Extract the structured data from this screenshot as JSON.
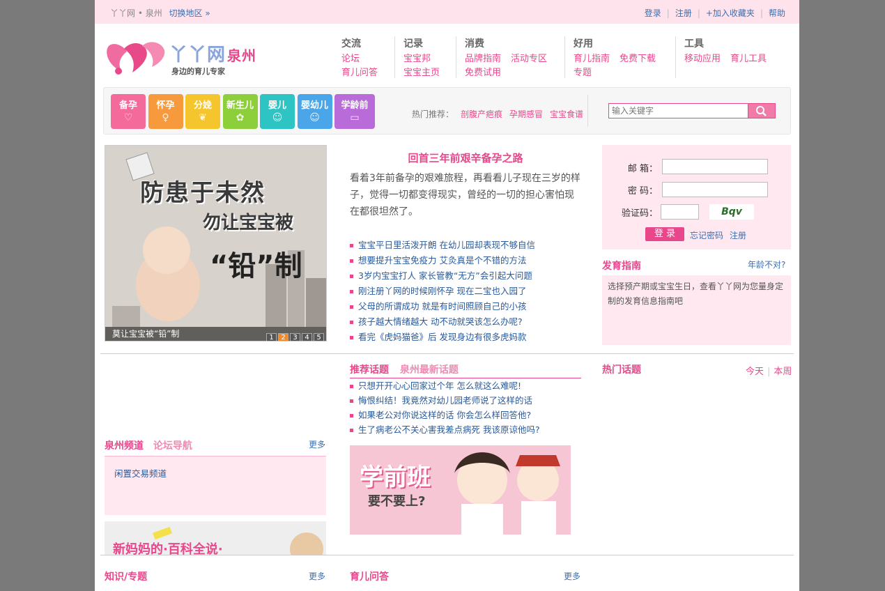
{
  "topbar": {
    "site_location": "丫丫网 • 泉州",
    "switch_region": "切换地区",
    "login": "登录",
    "register": "注册",
    "bookmark": "+加入收藏夹",
    "help": "帮助"
  },
  "logo": {
    "brand": "丫丫网",
    "city": "泉州",
    "slogan": "身边的育儿专家"
  },
  "nav": [
    {
      "heading": "交流",
      "rows": [
        [
          "论坛"
        ],
        [
          "育儿问答"
        ]
      ]
    },
    {
      "heading": "记录",
      "rows": [
        [
          "宝宝邦"
        ],
        [
          "宝宝主页"
        ]
      ]
    },
    {
      "heading": "消费",
      "rows": [
        [
          "品牌指南",
          "活动专区"
        ],
        [
          "免费试用"
        ]
      ]
    },
    {
      "heading": "好用",
      "rows": [
        [
          "育儿指南",
          "免费下载"
        ],
        [
          "专题"
        ]
      ]
    },
    {
      "heading": "工具",
      "rows": [
        [
          "移动应用",
          "育儿工具"
        ]
      ]
    }
  ],
  "categories": [
    {
      "label": "备孕",
      "color": "#f46a9b",
      "icon": "♡"
    },
    {
      "label": "怀孕",
      "color": "#f79a3e",
      "icon": "♀"
    },
    {
      "label": "分娩",
      "color": "#f5c52e",
      "icon": "❦"
    },
    {
      "label": "新生儿",
      "color": "#8ccf3a",
      "icon": "✿"
    },
    {
      "label": "婴儿",
      "color": "#2ec4c4",
      "icon": "☺"
    },
    {
      "label": "婴幼儿",
      "color": "#4aa6e8",
      "icon": "☺"
    },
    {
      "label": "学龄前",
      "color": "#b96bd9",
      "icon": "▭"
    }
  ],
  "hot": {
    "label": "热门推荐：",
    "items": [
      "剖腹产疤痕",
      "孕期感冒",
      "宝宝食谱"
    ]
  },
  "search": {
    "placeholder": "输入关键字"
  },
  "hero": {
    "line1": "防患于未然",
    "line2": "勿让宝宝被",
    "line3": "“铅”制",
    "caption": "莫让宝宝被“铅”制",
    "pages": [
      "1",
      "2",
      "3",
      "4",
      "5"
    ],
    "active_page": "2"
  },
  "headline": {
    "title": "回首三年前艰辛备孕之路",
    "summary": "看着3年前备孕的艰难旅程，再看看儿子现在三岁的样子，觉得一切都变得现实，曾经的一切的担心害怕现在都很坦然了。"
  },
  "news": [
    "宝宝平日里活泼开朗 在幼儿园却表现不够自信",
    "想要提升宝宝免疫力 艾灸真是个不错的方法",
    "3岁内宝宝打人 家长管教“无方”会引起大问题",
    "刚注册丫网的时候刚怀孕 现在二宝也入园了",
    "父母的所谓成功 就是有时间照顾自己的小孩",
    "孩子越大情绪越大 动不动就哭该怎么办呢?",
    "看完《虎妈猫爸》后 发现身边有很多虎妈款"
  ],
  "login": {
    "email_label": "邮  箱：",
    "password_label": "密  码：",
    "captcha_label": "验证码：",
    "captcha_text": "Bqv",
    "submit": "登 录",
    "forgot": "忘记密码",
    "register": "注册"
  },
  "growth": {
    "title": "发育指南",
    "age_link": "年龄不对?",
    "text": "选择预产期或宝宝生日，查看丫丫网为您量身定制的发育信息指南吧"
  },
  "topics": {
    "tab1": "推荐话题",
    "tab2": "泉州最新话题",
    "items": [
      "只想开开心心回家过个年 怎么就这么难呢!",
      "悔恨纠结！我竟然对幼儿园老师说了这样的话",
      "如果老公对你说这样的话 你会怎么样回答他?",
      "生了病老公不关心害我差点病死 我该原谅他吗?"
    ]
  },
  "hot_topics": {
    "title": "热门话题",
    "today": "今天",
    "week": "本周"
  },
  "promo": {
    "title": "学前班",
    "subtitle": "要不要上?"
  },
  "quanzhou": {
    "tab1": "泉州频道",
    "tab2": "论坛导航",
    "more": "更多",
    "item": "闲置交易频道"
  },
  "banner": {
    "text": "新妈妈的·百科全说·"
  },
  "bottom": {
    "knowledge": "知识/专题",
    "knowledge_more": "更多",
    "qa": "育儿问答",
    "qa_more": "更多"
  }
}
